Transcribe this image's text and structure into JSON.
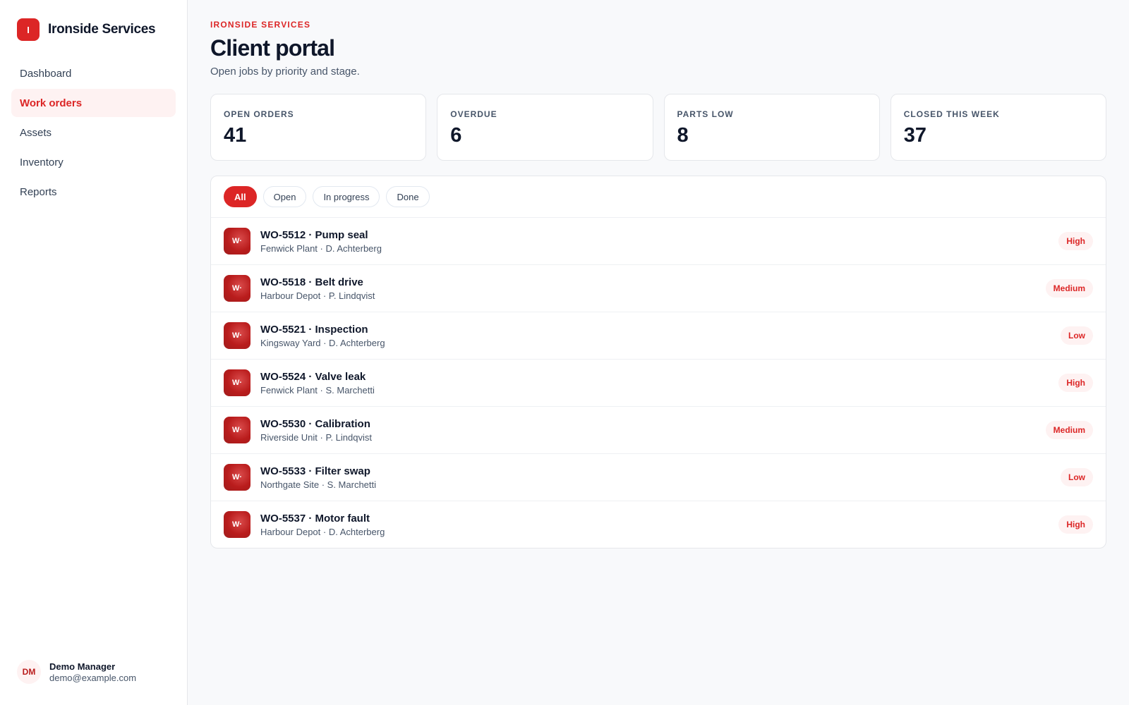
{
  "brand": {
    "logo_letter": "I",
    "name": "Ironside Services"
  },
  "nav": {
    "items": [
      {
        "label": "Dashboard",
        "active": false
      },
      {
        "label": "Work orders",
        "active": true
      },
      {
        "label": "Assets",
        "active": false
      },
      {
        "label": "Inventory",
        "active": false
      },
      {
        "label": "Reports",
        "active": false
      }
    ]
  },
  "user": {
    "initials": "DM",
    "name": "Demo Manager",
    "email": "demo@example.com"
  },
  "header": {
    "eyebrow": "IRONSIDE SERVICES",
    "title": "Client portal",
    "subtitle": "Open jobs by priority and stage."
  },
  "stats": [
    {
      "label": "OPEN ORDERS",
      "value": "41"
    },
    {
      "label": "OVERDUE",
      "value": "6"
    },
    {
      "label": "PARTS LOW",
      "value": "8"
    },
    {
      "label": "CLOSED THIS WEEK",
      "value": "37"
    }
  ],
  "filters": [
    {
      "label": "All",
      "active": true
    },
    {
      "label": "Open",
      "active": false
    },
    {
      "label": "In progress",
      "active": false
    },
    {
      "label": "Done",
      "active": false
    }
  ],
  "orders": [
    {
      "icon_text": "W·",
      "title": "WO-5512 · Pump seal",
      "subtitle": "Fenwick Plant · D. Achterberg",
      "priority": "High"
    },
    {
      "icon_text": "W·",
      "title": "WO-5518 · Belt drive",
      "subtitle": "Harbour Depot · P. Lindqvist",
      "priority": "Medium"
    },
    {
      "icon_text": "W·",
      "title": "WO-5521 · Inspection",
      "subtitle": "Kingsway Yard · D. Achterberg",
      "priority": "Low"
    },
    {
      "icon_text": "W·",
      "title": "WO-5524 · Valve leak",
      "subtitle": "Fenwick Plant · S. Marchetti",
      "priority": "High"
    },
    {
      "icon_text": "W·",
      "title": "WO-5530 · Calibration",
      "subtitle": "Riverside Unit · P. Lindqvist",
      "priority": "Medium"
    },
    {
      "icon_text": "W·",
      "title": "WO-5533 · Filter swap",
      "subtitle": "Northgate Site · S. Marchetti",
      "priority": "Low"
    },
    {
      "icon_text": "W·",
      "title": "WO-5537 · Motor fault",
      "subtitle": "Harbour Depot · D. Achterberg",
      "priority": "High"
    }
  ],
  "colors": {
    "accent": "#dc2626",
    "accent_soft": "#fef2f2",
    "icon_tile": "#b91c1c"
  }
}
